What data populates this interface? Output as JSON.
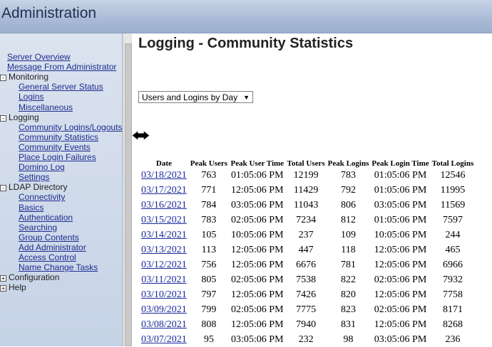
{
  "header": {
    "title": "Administration"
  },
  "sidebar": {
    "top_links": [
      "Server Overview",
      "Message From Administrator"
    ],
    "groups": [
      {
        "label": "Monitoring",
        "expanded": true,
        "items": [
          "General Server Status",
          "Logins",
          "Miscellaneous"
        ]
      },
      {
        "label": "Logging",
        "expanded": true,
        "items": [
          "Community Logins/Logouts",
          "Community Statistics",
          "Community Events",
          "Place Login Failures",
          "Domino Log",
          "Settings"
        ]
      },
      {
        "label": "LDAP Directory",
        "expanded": true,
        "items": [
          "Connectivity",
          "Basics",
          "Authentication",
          "Searching",
          "Group Contents",
          "Add Administrator",
          "Access Control",
          "Name Change Tasks"
        ]
      },
      {
        "label": "Configuration",
        "expanded": false,
        "items": []
      },
      {
        "label": "Help",
        "expanded": false,
        "items": []
      }
    ]
  },
  "main": {
    "title": "Logging - Community Statistics",
    "view_select": "Users and Logins by Day",
    "nav_arrows": "←→",
    "table": {
      "headers": [
        "Date",
        "Peak Users",
        "Peak User Time",
        "Total Users",
        "Peak Logins",
        "Peak Login Time",
        "Total Logins"
      ],
      "rows": [
        [
          "03/18/2021",
          "763",
          "01:05:06 PM",
          "12199",
          "783",
          "01:05:06 PM",
          "12546"
        ],
        [
          "03/17/2021",
          "771",
          "12:05:06 PM",
          "11429",
          "792",
          "01:05:06 PM",
          "11995"
        ],
        [
          "03/16/2021",
          "784",
          "03:05:06 PM",
          "11043",
          "806",
          "03:05:06 PM",
          "11569"
        ],
        [
          "03/15/2021",
          "783",
          "02:05:06 PM",
          "7234",
          "812",
          "01:05:06 PM",
          "7597"
        ],
        [
          "03/14/2021",
          "105",
          "10:05:06 PM",
          "237",
          "109",
          "10:05:06 PM",
          "244"
        ],
        [
          "03/13/2021",
          "113",
          "12:05:06 PM",
          "447",
          "118",
          "12:05:06 PM",
          "465"
        ],
        [
          "03/12/2021",
          "756",
          "12:05:06 PM",
          "6676",
          "781",
          "12:05:06 PM",
          "6966"
        ],
        [
          "03/11/2021",
          "805",
          "02:05:06 PM",
          "7538",
          "822",
          "02:05:06 PM",
          "7932"
        ],
        [
          "03/10/2021",
          "797",
          "12:05:06 PM",
          "7426",
          "820",
          "12:05:06 PM",
          "7758"
        ],
        [
          "03/09/2021",
          "799",
          "02:05:06 PM",
          "7775",
          "823",
          "02:05:06 PM",
          "8171"
        ],
        [
          "03/08/2021",
          "808",
          "12:05:06 PM",
          "7940",
          "831",
          "12:05:06 PM",
          "8268"
        ],
        [
          "03/07/2021",
          "95",
          "03:05:06 PM",
          "232",
          "98",
          "03:05:06 PM",
          "236"
        ]
      ]
    }
  }
}
